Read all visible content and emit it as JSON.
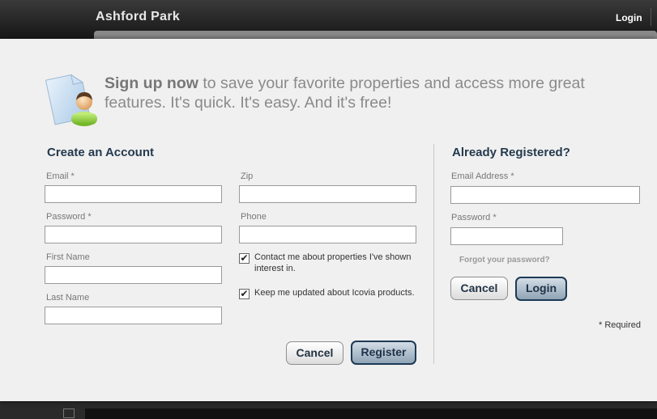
{
  "header": {
    "site_title": "Ashford Park",
    "login_label": "Login"
  },
  "hero": {
    "highlight": "Sign up now",
    "text": " to save your favorite properties and access more great features.  It's quick.  It's easy.  And it's free!",
    "icon": "user-document-icon"
  },
  "create_account": {
    "title": "Create an Account",
    "fields": {
      "email": {
        "label": "Email *",
        "value": ""
      },
      "password": {
        "label": "Password *",
        "value": ""
      },
      "first_name": {
        "label": "First Name",
        "value": ""
      },
      "last_name": {
        "label": "Last Name",
        "value": ""
      },
      "zip": {
        "label": "Zip",
        "value": ""
      },
      "phone": {
        "label": "Phone",
        "value": ""
      }
    },
    "checkboxes": {
      "contact_me": {
        "label": "Contact me about properties I've shown interest in.",
        "checked": true,
        "mark": "✔"
      },
      "updates": {
        "label": "Keep me updated about Icovia products.",
        "checked": true,
        "mark": "✔"
      }
    },
    "cancel_label": "Cancel",
    "register_label": "Register"
  },
  "already_registered": {
    "title": "Already Registered?",
    "email_label": "Email Address *",
    "email_value": "",
    "password_label": "Password *",
    "password_value": "",
    "forgot_label": "Forgot your password?",
    "cancel_label": "Cancel",
    "login_label": "Login"
  },
  "required_note": "* Required",
  "colors": {
    "accent": "#243a4e",
    "primary_button": "#8fa4b6",
    "background": "#f0f0f0"
  }
}
